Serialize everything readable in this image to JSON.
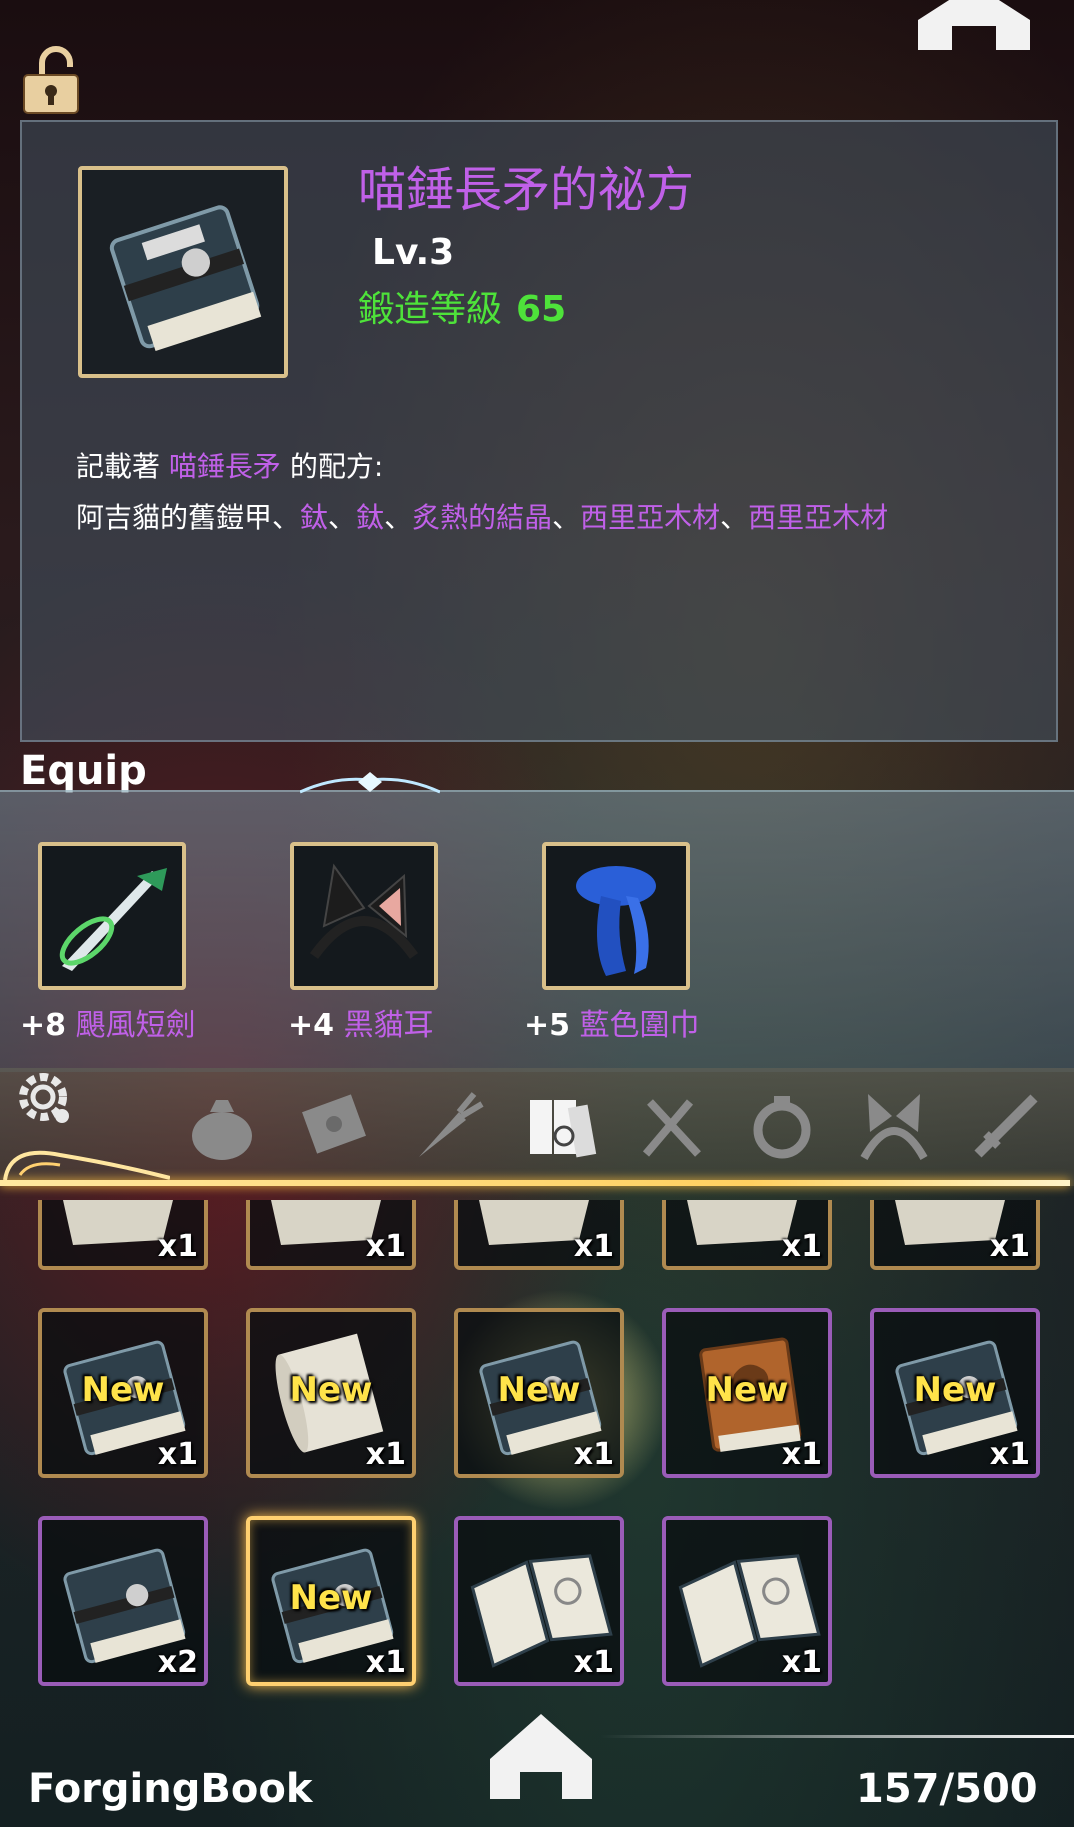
{
  "header": {
    "home_icon": "home-icon",
    "lock_icon": "unlocked-padlock-icon"
  },
  "item": {
    "icon": "blue-recipe-book-icon",
    "title": "喵錘長矛的祕方",
    "level": "Lv.3",
    "forge_label": "鍛造等級",
    "forge_value": "65",
    "desc_prefix": "記載著",
    "desc_target": "喵錘長矛",
    "desc_suffix": "的配方:",
    "materials": [
      {
        "name": "阿吉貓的舊鎧甲",
        "color": "#ffffff"
      },
      {
        "name": "鈦",
        "color": "#c060e8"
      },
      {
        "name": "鈦",
        "color": "#c060e8"
      },
      {
        "name": "炙熱的結晶",
        "color": "#c060e8"
      },
      {
        "name": "西里亞木材",
        "color": "#c060e8"
      },
      {
        "name": "西里亞木材",
        "color": "#c060e8"
      }
    ],
    "separator": "、"
  },
  "equip": {
    "label": "Equip",
    "slots": [
      {
        "plus": "+8",
        "name": "颶風短劍",
        "icon": "green-dagger-icon"
      },
      {
        "plus": "+4",
        "name": "黑貓耳",
        "icon": "cat-ears-headband-icon"
      },
      {
        "plus": "+5",
        "name": "藍色圍巾",
        "icon": "blue-scarf-icon"
      }
    ]
  },
  "categories": [
    "bag-icon",
    "letter-icon",
    "carrot-icon",
    "books-icon",
    "utensils-icon",
    "ring-icon",
    "cat-ears-icon",
    "sword-icon"
  ],
  "categories_active": 3,
  "grid": {
    "new_label": "New",
    "partial_row": [
      {
        "qty": "x1"
      },
      {
        "qty": "x1"
      },
      {
        "qty": "x1"
      },
      {
        "qty": "x1"
      },
      {
        "qty": "x1"
      }
    ],
    "row2": [
      {
        "qty": "x1",
        "new": true,
        "icon": "blue-book-icon"
      },
      {
        "qty": "x1",
        "new": true,
        "icon": "scroll-icon"
      },
      {
        "qty": "x1",
        "new": true,
        "icon": "blue-book-icon"
      },
      {
        "qty": "x1",
        "new": true,
        "icon": "brown-book-icon"
      },
      {
        "qty": "x1",
        "new": true,
        "icon": "blue-book-icon"
      }
    ],
    "row3": [
      {
        "qty": "x2",
        "new": false,
        "icon": "blue-book-icon"
      },
      {
        "qty": "x1",
        "new": true,
        "icon": "blue-book-icon"
      },
      {
        "qty": "x1",
        "new": false,
        "icon": "open-book-icon"
      },
      {
        "qty": "x1",
        "new": false,
        "icon": "open-book-icon"
      }
    ]
  },
  "footer": {
    "label": "ForgingBook",
    "count": "157/500"
  },
  "colors": {
    "accent_purple": "#c060e8",
    "forge_green": "#4ee23a",
    "frame_gold": "#d9c08a"
  }
}
